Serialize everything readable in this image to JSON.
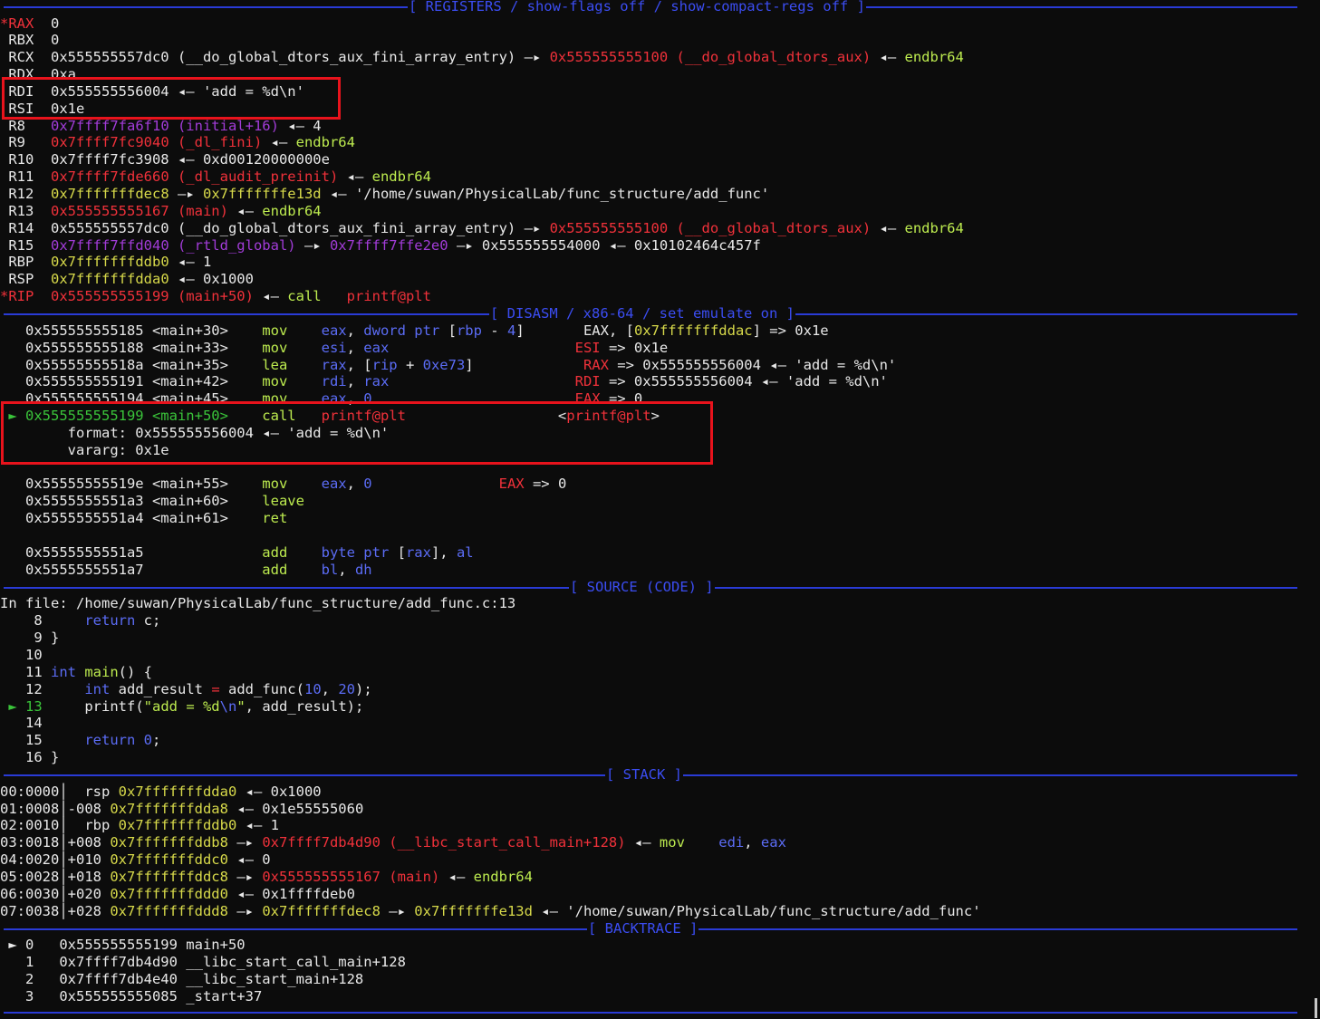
{
  "colors": {
    "w": "#e8e8e8",
    "r": "#f0313a",
    "p": "#a23cd8",
    "y": "#d7d94a",
    "g": "#bdeb4f",
    "b": "#5b6cf5",
    "gr": "#3ac43a",
    "dm": "#8a8a8a"
  },
  "headers": {
    "registers": "[ REGISTERS / show-flags off / show-compact-regs off ]",
    "disasm": "[ DISASM / x86-64 / set emulate on ]",
    "source": "[ SOURCE (CODE) ]",
    "stack": "[ STACK ]",
    "backtrace": "[ BACKTRACE ]"
  },
  "lines": [
    {
      "name": "reg-rax",
      "segs": [
        [
          "r",
          "*RAX"
        ],
        [
          "w",
          "  0"
        ]
      ]
    },
    {
      "name": "reg-rbx",
      "segs": [
        [
          "w",
          " RBX  0"
        ]
      ]
    },
    {
      "name": "reg-rcx",
      "segs": [
        [
          "w",
          " RCX  0x555555557dc0 (__do_global_dtors_aux_fini_array_entry) —▸ "
        ],
        [
          "r",
          "0x555555555100 (__do_global_dtors_aux)"
        ],
        [
          "w",
          " ◂— "
        ],
        [
          "g",
          "endbr64"
        ]
      ]
    },
    {
      "name": "reg-rdx",
      "segs": [
        [
          "w",
          " RDX  0xa"
        ]
      ]
    },
    {
      "name": "reg-rdi",
      "segs": [
        [
          "w",
          " RDI  0x555555556004 ◂— 'add = %d\\n'"
        ]
      ]
    },
    {
      "name": "reg-rsi",
      "segs": [
        [
          "w",
          " RSI  0x1e"
        ]
      ]
    },
    {
      "name": "reg-r8",
      "segs": [
        [
          "w",
          " R8   "
        ],
        [
          "p",
          "0x7ffff7fa6f10 (initial+16)"
        ],
        [
          "w",
          " ◂— 4"
        ]
      ]
    },
    {
      "name": "reg-r9",
      "segs": [
        [
          "w",
          " R9   "
        ],
        [
          "r",
          "0x7ffff7fc9040 (_dl_fini)"
        ],
        [
          "w",
          " ◂— "
        ],
        [
          "g",
          "endbr64"
        ]
      ]
    },
    {
      "name": "reg-r10",
      "segs": [
        [
          "w",
          " R10  0x7ffff7fc3908 ◂— 0xd00120000000e"
        ]
      ]
    },
    {
      "name": "reg-r11",
      "segs": [
        [
          "w",
          " R11  "
        ],
        [
          "r",
          "0x7ffff7fde660 (_dl_audit_preinit)"
        ],
        [
          "w",
          " ◂— "
        ],
        [
          "g",
          "endbr64"
        ]
      ]
    },
    {
      "name": "reg-r12",
      "segs": [
        [
          "w",
          " R12  "
        ],
        [
          "y",
          "0x7fffffffdec8"
        ],
        [
          "w",
          " —▸ "
        ],
        [
          "y",
          "0x7fffffffe13d"
        ],
        [
          "w",
          " ◂— '/home/suwan/PhysicalLab/func_structure/add_func'"
        ]
      ]
    },
    {
      "name": "reg-r13",
      "segs": [
        [
          "w",
          " R13  "
        ],
        [
          "r",
          "0x555555555167 (main)"
        ],
        [
          "w",
          " ◂— "
        ],
        [
          "g",
          "endbr64"
        ]
      ]
    },
    {
      "name": "reg-r14",
      "segs": [
        [
          "w",
          " R14  0x555555557dc0 (__do_global_dtors_aux_fini_array_entry) —▸ "
        ],
        [
          "r",
          "0x555555555100 (__do_global_dtors_aux)"
        ],
        [
          "w",
          " ◂— "
        ],
        [
          "g",
          "endbr64"
        ]
      ]
    },
    {
      "name": "reg-r15",
      "segs": [
        [
          "w",
          " R15  "
        ],
        [
          "p",
          "0x7ffff7ffd040 (_rtld_global)"
        ],
        [
          "w",
          " —▸ "
        ],
        [
          "p",
          "0x7ffff7ffe2e0"
        ],
        [
          "w",
          " —▸ 0x555555554000 ◂— 0x10102464c457f"
        ]
      ]
    },
    {
      "name": "reg-rbp",
      "segs": [
        [
          "w",
          " RBP  "
        ],
        [
          "y",
          "0x7fffffffddb0"
        ],
        [
          "w",
          " ◂— 1"
        ]
      ]
    },
    {
      "name": "reg-rsp",
      "segs": [
        [
          "w",
          " RSP  "
        ],
        [
          "y",
          "0x7fffffffdda0"
        ],
        [
          "w",
          " ◂— 0x1000"
        ]
      ]
    },
    {
      "name": "reg-rip",
      "segs": [
        [
          "r",
          "*RIP  0x555555555199 (main+50)"
        ],
        [
          "w",
          " ◂— "
        ],
        [
          "g",
          "call   "
        ],
        [
          "r",
          "printf@plt"
        ]
      ]
    },
    {
      "name": "header-disasm",
      "header": "disasm",
      "pos": 540
    },
    {
      "name": "disasm-line",
      "segs": [
        [
          "w",
          "   0x555555555185 <main+30>    "
        ],
        [
          "g",
          "mov    "
        ],
        [
          "b",
          "eax"
        ],
        [
          "w",
          ", "
        ],
        [
          "b",
          "dword ptr"
        ],
        [
          "w",
          " ["
        ],
        [
          "b",
          "rbp"
        ],
        [
          "w",
          " - "
        ],
        [
          "b",
          "4"
        ],
        [
          "w",
          "]       EAX, ["
        ],
        [
          "y",
          "0x7fffffffddac"
        ],
        [
          "w",
          "] => 0x1e"
        ]
      ]
    },
    {
      "name": "disasm-line",
      "segs": [
        [
          "w",
          "   0x555555555188 <main+33>    "
        ],
        [
          "g",
          "mov    "
        ],
        [
          "b",
          "esi"
        ],
        [
          "w",
          ", "
        ],
        [
          "b",
          "eax"
        ],
        [
          "w",
          "                      "
        ],
        [
          "r",
          "ESI"
        ],
        [
          "w",
          " => 0x1e"
        ]
      ]
    },
    {
      "name": "disasm-line",
      "segs": [
        [
          "w",
          "   0x55555555518a <main+35>    "
        ],
        [
          "g",
          "lea    "
        ],
        [
          "b",
          "rax"
        ],
        [
          "w",
          ", ["
        ],
        [
          "b",
          "rip"
        ],
        [
          "w",
          " + "
        ],
        [
          "b",
          "0xe73"
        ],
        [
          "w",
          "]             "
        ],
        [
          "r",
          "RAX"
        ],
        [
          "w",
          " => 0x555555556004 ◂— 'add = %d\\n'"
        ]
      ]
    },
    {
      "name": "disasm-line",
      "segs": [
        [
          "w",
          "   0x555555555191 <main+42>    "
        ],
        [
          "g",
          "mov    "
        ],
        [
          "b",
          "rdi"
        ],
        [
          "w",
          ", "
        ],
        [
          "b",
          "rax"
        ],
        [
          "w",
          "                      "
        ],
        [
          "r",
          "RDI"
        ],
        [
          "w",
          " => 0x555555556004 ◂— 'add = %d\\n'"
        ]
      ]
    },
    {
      "name": "disasm-line",
      "segs": [
        [
          "w",
          "   0x555555555194 <main+45>    "
        ],
        [
          "g",
          "mov    "
        ],
        [
          "b",
          "eax"
        ],
        [
          "w",
          ", "
        ],
        [
          "b",
          "0"
        ],
        [
          "w",
          "                        "
        ],
        [
          "r",
          "EAX"
        ],
        [
          "w",
          " => 0"
        ]
      ]
    },
    {
      "name": "disasm-current-line",
      "segs": [
        [
          "gr",
          " ► 0x555555555199 <main+50>    "
        ],
        [
          "g",
          "call   "
        ],
        [
          "r",
          "printf@plt"
        ],
        [
          "w",
          "                  <"
        ],
        [
          "r",
          "printf@plt"
        ],
        [
          "w",
          ">"
        ]
      ]
    },
    {
      "name": "disasm-arg-format",
      "segs": [
        [
          "w",
          "        format: 0x555555556004 ◂— 'add = %d\\n'"
        ]
      ]
    },
    {
      "name": "disasm-arg-vararg",
      "segs": [
        [
          "w",
          "        vararg: 0x1e"
        ]
      ]
    },
    {
      "name": "blank",
      "segs": [
        [
          "w",
          " "
        ]
      ]
    },
    {
      "name": "disasm-line",
      "segs": [
        [
          "w",
          "   0x55555555519e <main+55>    "
        ],
        [
          "g",
          "mov    "
        ],
        [
          "b",
          "eax"
        ],
        [
          "w",
          ", "
        ],
        [
          "b",
          "0"
        ],
        [
          "w",
          "               "
        ],
        [
          "r",
          "EAX"
        ],
        [
          "w",
          " => 0"
        ]
      ]
    },
    {
      "name": "disasm-line",
      "segs": [
        [
          "w",
          "   0x5555555551a3 <main+60>    "
        ],
        [
          "g",
          "leave"
        ]
      ]
    },
    {
      "name": "disasm-line",
      "segs": [
        [
          "w",
          "   0x5555555551a4 <main+61>    "
        ],
        [
          "g",
          "ret"
        ]
      ]
    },
    {
      "name": "blank",
      "segs": [
        [
          "w",
          " "
        ]
      ]
    },
    {
      "name": "disasm-line",
      "segs": [
        [
          "w",
          "   0x5555555551a5              "
        ],
        [
          "g",
          "add    "
        ],
        [
          "b",
          "byte ptr"
        ],
        [
          "w",
          " ["
        ],
        [
          "b",
          "rax"
        ],
        [
          "w",
          "], "
        ],
        [
          "b",
          "al"
        ]
      ]
    },
    {
      "name": "disasm-line",
      "segs": [
        [
          "w",
          "   0x5555555551a7              "
        ],
        [
          "g",
          "add    "
        ],
        [
          "b",
          "bl"
        ],
        [
          "w",
          ", "
        ],
        [
          "b",
          "dh"
        ]
      ]
    },
    {
      "name": "header-source",
      "header": "source",
      "pos": 628
    },
    {
      "name": "source-file",
      "segs": [
        [
          "w",
          "In file: /home/suwan/PhysicalLab/func_structure/add_func.c:13"
        ]
      ]
    },
    {
      "name": "source-line",
      "segs": [
        [
          "w",
          "    8     "
        ],
        [
          "b",
          "return"
        ],
        [
          "w",
          " c;"
        ]
      ]
    },
    {
      "name": "source-line",
      "segs": [
        [
          "w",
          "    9 }"
        ]
      ]
    },
    {
      "name": "source-line",
      "segs": [
        [
          "w",
          "   10"
        ]
      ]
    },
    {
      "name": "source-line",
      "segs": [
        [
          "w",
          "   11 "
        ],
        [
          "b",
          "int"
        ],
        [
          "w",
          " "
        ],
        [
          "g",
          "main"
        ],
        [
          "w",
          "() {"
        ]
      ]
    },
    {
      "name": "source-line",
      "segs": [
        [
          "w",
          "   12     "
        ],
        [
          "b",
          "int"
        ],
        [
          "w",
          " add_result "
        ],
        [
          "r",
          "="
        ],
        [
          "w",
          " add_func("
        ],
        [
          "b",
          "10"
        ],
        [
          "w",
          ", "
        ],
        [
          "b",
          "20"
        ],
        [
          "w",
          ");"
        ]
      ]
    },
    {
      "name": "source-current-line",
      "segs": [
        [
          "gr",
          " ► 13"
        ],
        [
          "w",
          "     printf("
        ],
        [
          "g",
          "\"add = %d"
        ],
        [
          "b",
          "\\n"
        ],
        [
          "g",
          "\""
        ],
        [
          "w",
          ", add_result);"
        ]
      ]
    },
    {
      "name": "source-line",
      "segs": [
        [
          "w",
          "   14"
        ]
      ]
    },
    {
      "name": "source-line",
      "segs": [
        [
          "w",
          "   15     "
        ],
        [
          "b",
          "return"
        ],
        [
          "w",
          " "
        ],
        [
          "b",
          "0"
        ],
        [
          "w",
          ";"
        ]
      ]
    },
    {
      "name": "source-line",
      "segs": [
        [
          "w",
          "   16 }"
        ]
      ]
    },
    {
      "name": "header-stack",
      "header": "stack",
      "pos": 668
    },
    {
      "name": "stack-line",
      "segs": [
        [
          "w",
          "00:0000│  rsp "
        ],
        [
          "y",
          "0x7fffffffdda0"
        ],
        [
          "w",
          " ◂— 0x1000"
        ]
      ]
    },
    {
      "name": "stack-line",
      "segs": [
        [
          "w",
          "01:0008│-008 "
        ],
        [
          "y",
          "0x7fffffffdda8"
        ],
        [
          "w",
          " ◂— 0x1e55555060"
        ]
      ]
    },
    {
      "name": "stack-line",
      "segs": [
        [
          "w",
          "02:0010│  rbp "
        ],
        [
          "y",
          "0x7fffffffddb0"
        ],
        [
          "w",
          " ◂— 1"
        ]
      ]
    },
    {
      "name": "stack-line",
      "segs": [
        [
          "w",
          "03:0018│+008 "
        ],
        [
          "y",
          "0x7fffffffddb8"
        ],
        [
          "w",
          " —▸ "
        ],
        [
          "r",
          "0x7ffff7db4d90 (__libc_start_call_main+128)"
        ],
        [
          "w",
          " ◂— "
        ],
        [
          "g",
          "mov    "
        ],
        [
          "b",
          "edi"
        ],
        [
          "w",
          ", "
        ],
        [
          "b",
          "eax"
        ]
      ]
    },
    {
      "name": "stack-line",
      "segs": [
        [
          "w",
          "04:0020│+010 "
        ],
        [
          "y",
          "0x7fffffffddc0"
        ],
        [
          "w",
          " ◂— 0"
        ]
      ]
    },
    {
      "name": "stack-line",
      "segs": [
        [
          "w",
          "05:0028│+018 "
        ],
        [
          "y",
          "0x7fffffffddc8"
        ],
        [
          "w",
          " —▸ "
        ],
        [
          "r",
          "0x555555555167 (main)"
        ],
        [
          "w",
          " ◂— "
        ],
        [
          "g",
          "endbr64"
        ]
      ]
    },
    {
      "name": "stack-line",
      "segs": [
        [
          "w",
          "06:0030│+020 "
        ],
        [
          "y",
          "0x7fffffffddd0"
        ],
        [
          "w",
          " ◂— 0x1ffffdeb0"
        ]
      ]
    },
    {
      "name": "stack-line",
      "segs": [
        [
          "w",
          "07:0038│+028 "
        ],
        [
          "y",
          "0x7fffffffddd8"
        ],
        [
          "w",
          " —▸ "
        ],
        [
          "y",
          "0x7fffffffdec8"
        ],
        [
          "w",
          " —▸ "
        ],
        [
          "y",
          "0x7fffffffe13d"
        ],
        [
          "w",
          " ◂— '/home/suwan/PhysicalLab/func_structure/add_func'"
        ]
      ]
    },
    {
      "name": "header-backtrace",
      "header": "backtrace",
      "pos": 648
    },
    {
      "name": "backtrace-line",
      "segs": [
        [
          "w",
          " ► 0   0x555555555199 main+50"
        ]
      ]
    },
    {
      "name": "backtrace-line",
      "segs": [
        [
          "w",
          "   1   0x7ffff7db4d90 __libc_start_call_main+128"
        ]
      ]
    },
    {
      "name": "backtrace-line",
      "segs": [
        [
          "w",
          "   2   0x7ffff7db4e40 __libc_start_main+128"
        ]
      ]
    },
    {
      "name": "backtrace-line",
      "segs": [
        [
          "w",
          "   3   0x555555555085 _start+37"
        ]
      ]
    }
  ]
}
